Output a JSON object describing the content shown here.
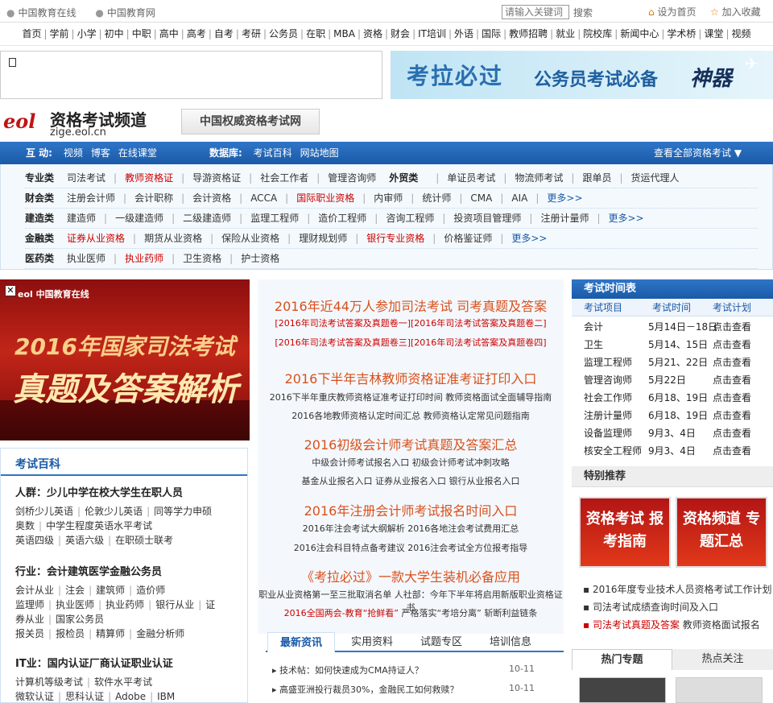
{
  "topbar": {
    "link1": "中国教育在线",
    "link2": "中国教育网",
    "search_placeholder": "请输入关键词",
    "search_label": "搜索",
    "home": "设为首页",
    "fav": "加入收藏"
  },
  "nav": [
    "首页",
    "学前",
    "小学",
    "初中",
    "中职",
    "高中",
    "高考",
    "自考",
    "考研",
    "公务员",
    "在职",
    "MBA",
    "资格",
    "财会",
    "IT培训",
    "外语",
    "国际",
    "教师招聘",
    "就业",
    "院校库",
    "新闻中心",
    "学术桥",
    "课堂",
    "视频"
  ],
  "banner": {
    "t1": "考拉必过",
    "t2": "公务员考试必备",
    "t3": "神器"
  },
  "logo": {
    "eol": "eol",
    "title": "资格考试频道",
    "url": "zige.eol.cn",
    "slogan": "中国权威资格考试网"
  },
  "bluebar": {
    "interact_label": "互 动:",
    "interact": [
      "视频",
      "博客",
      "在线课堂"
    ],
    "db_label": "数据库:",
    "db": [
      "考试百科",
      "网站地图"
    ],
    "all": "查看全部资格考试 ▼"
  },
  "cats": [
    {
      "label": "专业类",
      "items": [
        {
          "t": "司法考试"
        },
        {
          "t": "教师资格证",
          "red": true
        },
        {
          "t": "导游资格证"
        },
        {
          "t": "社会工作者"
        },
        {
          "t": "管理咨询师"
        },
        {
          "t": "外贸类",
          "bold": true
        },
        {
          "t": "单证员考试"
        },
        {
          "t": "物流师考试"
        },
        {
          "t": "跟单员"
        },
        {
          "t": "货运代理人"
        }
      ]
    },
    {
      "label": "财会类",
      "items": [
        {
          "t": "注册会计师"
        },
        {
          "t": "会计职称"
        },
        {
          "t": "会计资格"
        },
        {
          "t": "ACCA"
        },
        {
          "t": "国际职业资格",
          "red": true
        },
        {
          "t": "内审师"
        },
        {
          "t": "统计师"
        },
        {
          "t": "CMA"
        },
        {
          "t": "AIA"
        },
        {
          "t": "更多>>",
          "more": true
        }
      ]
    },
    {
      "label": "建造类",
      "items": [
        {
          "t": "建造师"
        },
        {
          "t": "一级建造师"
        },
        {
          "t": "二级建造师"
        },
        {
          "t": "监理工程师"
        },
        {
          "t": "造价工程师"
        },
        {
          "t": "咨询工程师"
        },
        {
          "t": "投资项目管理师"
        },
        {
          "t": "注册计量师"
        },
        {
          "t": "更多>>",
          "more": true
        }
      ]
    },
    {
      "label": "金融类",
      "items": [
        {
          "t": "证券从业资格",
          "red": true
        },
        {
          "t": "期货从业资格"
        },
        {
          "t": "保险从业资格"
        },
        {
          "t": "理财规划师"
        },
        {
          "t": "银行专业资格",
          "red": true
        },
        {
          "t": "价格鉴证师"
        },
        {
          "t": "更多>>",
          "more": true
        }
      ]
    },
    {
      "label": "医药类",
      "items": [
        {
          "t": "执业医师"
        },
        {
          "t": "执业药师",
          "red": true
        },
        {
          "t": "卫生资格"
        },
        {
          "t": "护士资格"
        }
      ]
    }
  ],
  "leftad": {
    "logo": "中国教育在线",
    "h1": "2016年国家司法考试",
    "h2": "真题及答案解析"
  },
  "wiki": {
    "title": "考试百科",
    "s1": "人群：少儿中学在校大学生在职人员",
    "s1l": [
      [
        "剑桥少儿英语",
        "伦敦少儿英语",
        "同等学力申硕"
      ],
      [
        "奥数",
        "中学生程度英语水平考试"
      ],
      [
        "英语四级",
        "英语六级",
        "在职硕士联考"
      ]
    ],
    "s2": "行业：会计建筑医学金融公务员",
    "s2l": [
      [
        "会计从业",
        "注会",
        "建筑师",
        "造价师"
      ],
      [
        "监理师",
        "执业医师",
        "执业药师",
        "银行从业",
        "证"
      ],
      [
        "券从业",
        "国家公务员"
      ],
      [
        "报关员",
        "报检员",
        "精算师",
        "金融分析师"
      ]
    ],
    "s3": "IT业：国内认证厂商认证职业认证",
    "s3l": [
      [
        "计算机等级考试",
        "软件水平考试"
      ],
      [
        "微软认证",
        "思科认证",
        "Adobe",
        "IBM"
      ]
    ]
  },
  "center": {
    "h1": "2016年近44万人参加司法考试 司考真题及答案",
    "h1a": "[2016年司法考试答案及真题卷一][2016年司法考试答案及真题卷二]",
    "h1b": "[2016年司法考试答案及真题卷三][2016年司法考试答案及真题卷四]",
    "h2": "2016下半年吉林教师资格证准考证打印入口",
    "h2a": "2016下半年重庆教师资格证准考证打印时间 教师资格面试全面辅导指南",
    "h2b": "2016各地教师资格认定时间汇总 教师资格认定常见问题指南",
    "h3": "2016初级会计师考试真题及答案汇总",
    "h3a": "中级会计师考试报名入口 初级会计师考试冲刺攻略",
    "h3b": "基金从业报名入口 证券从业报名入口 银行从业报名入口",
    "h4": "2016年注册会计师考试报名时间入口",
    "h4a": "2016年注会考试大纲解析 2016各地注会考试费用汇总",
    "h4b": "2016注会科目特点备考建议 2016注会考试全方位报考指导",
    "h5": "《考拉必过》一款大学生装机必备应用",
    "h5a": "职业从业资格第一至三批取消名单 人社部：今年下半年将启用新版职业资格证书",
    "h5b_red": "2016全国两会-教育“抢鲜看”",
    "h5b": "严格落实“考培分离” 斩断利益链条",
    "tabs": [
      "最新资讯",
      "实用资料",
      "试题专区",
      "培训信息"
    ],
    "news": [
      {
        "t": "▸ 技术帖：如何快速成为CMA持证人？",
        "d": "10-11"
      },
      {
        "t": "▸ 高盛亚洲投行裁员30%，金融民工如何救赎？",
        "d": "10-11"
      }
    ]
  },
  "schedule": {
    "title": "考试时间表",
    "cols": [
      "考试项目",
      "考试时间",
      "考试计划"
    ],
    "rows": [
      [
        "会计",
        "5月14日－18日",
        "点击查看"
      ],
      [
        "卫生",
        "5月14、15日",
        "点击查看"
      ],
      [
        "监理工程师",
        "5月21、22日",
        "点击查看"
      ],
      [
        "管理咨询师",
        "5月22日",
        "点击查看"
      ],
      [
        "社会工作师",
        "6月18、19日",
        "点击查看"
      ],
      [
        "注册计量师",
        "6月18、19日",
        "点击查看"
      ],
      [
        "设备监理师",
        "9月3、4日",
        "点击查看"
      ],
      [
        "核安全工程师",
        "9月3、4日",
        "点击查看"
      ]
    ]
  },
  "special": {
    "title": "特别推荐",
    "img1": "资格考试 报考指南",
    "img2": "资格频道 专题汇总",
    "l1": "▪ 2016年度专业技术人员资格考试工作计划",
    "l2": "▪ 司法考试成绩查询时间及入口",
    "l3r": "▪ 司法考试真题及答案",
    "l3": "教师资格面试报名"
  },
  "hot": {
    "t1": "热门专题",
    "t2": "热点关注"
  }
}
